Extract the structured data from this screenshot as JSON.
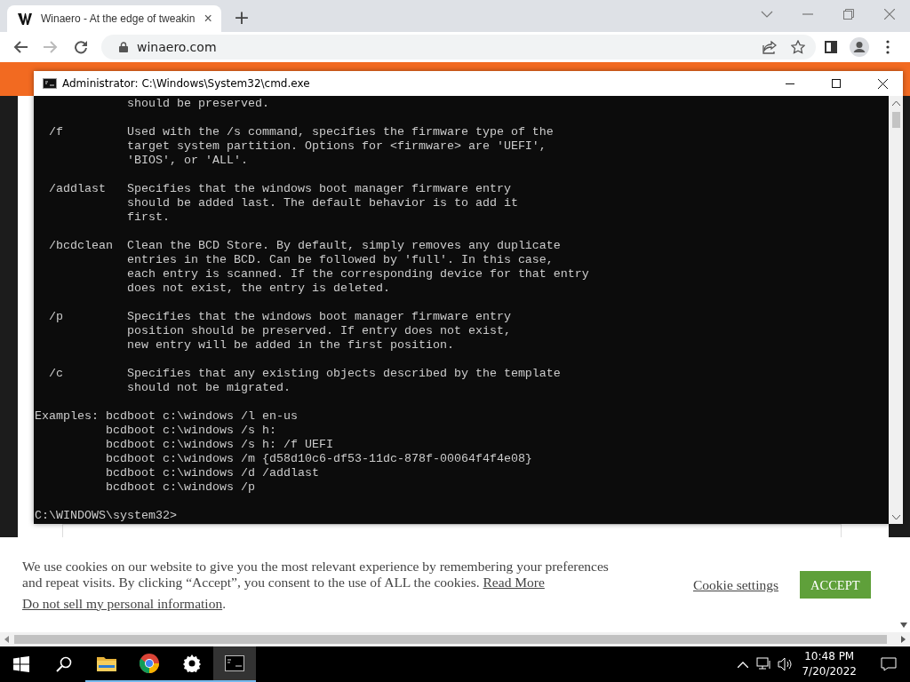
{
  "browser": {
    "tabs": [
      {
        "title": "Winaero - At the edge of tweakin",
        "close": "×",
        "selected": true
      }
    ],
    "new_tab": "+",
    "nav_buttons": [
      {
        "kind": "back",
        "disabled": false
      },
      {
        "kind": "forward",
        "disabled": true
      },
      {
        "kind": "reload",
        "disabled": false
      }
    ],
    "address": "winaero.com"
  },
  "console_window": {
    "title": "Administrator: C:\\Windows\\System32\\cmd.exe",
    "blocks": [
      [
        "             should be preserved."
      ],
      [
        "  /f         Used with the /s command, specifies the firmware type of the",
        "             target system partition. Options for <firmware> are 'UEFI',",
        "             'BIOS', or 'ALL'."
      ],
      [
        "  /addlast   Specifies that the windows boot manager firmware entry",
        "             should be added last. The default behavior is to add it",
        "             first."
      ],
      [
        "  /bcdclean  Clean the BCD Store. By default, simply removes any duplicate",
        "             entries in the BCD. Can be followed by 'full'. In this case,",
        "             each entry is scanned. If the corresponding device for that entry",
        "             does not exist, the entry is deleted."
      ],
      [
        "  /p         Specifies that the windows boot manager firmware entry",
        "             position should be preserved. If entry does not exist,",
        "             new entry will be added in the first position."
      ],
      [
        "  /c         Specifies that any existing objects described by the template",
        "             should not be migrated."
      ],
      [
        "Examples: bcdboot c:\\windows /l en-us",
        "          bcdboot c:\\windows /s h:",
        "          bcdboot c:\\windows /s h: /f UEFI",
        "          bcdboot c:\\windows /m {d58d10c6-df53-11dc-878f-00064f4f4e08}",
        "          bcdboot c:\\windows /d /addlast",
        "          bcdboot c:\\windows /p"
      ],
      [
        "C:\\WINDOWS\\system32>"
      ]
    ]
  },
  "cookie_banner": {
    "notice": "We use cookies on our website to give you the most relevant experience by remembering your preferences and repeat visits. By clicking “Accept”, you consent to the use of ALL the cookies.",
    "read_more": "Read More",
    "do_not_sell": "Do not sell my personal information",
    "do_not_sell_end": ".",
    "settings": "Cookie settings",
    "accept": "ACCEPT"
  },
  "taskbar": {
    "items": [
      {
        "kind": "start",
        "running": false,
        "selected": false
      },
      {
        "kind": "search",
        "running": false,
        "selected": false
      },
      {
        "kind": "explorer",
        "running": true,
        "selected": false
      },
      {
        "kind": "chrome",
        "running": true,
        "selected": false
      },
      {
        "kind": "settings",
        "running": true,
        "selected": false
      },
      {
        "kind": "console",
        "running": true,
        "selected": true
      }
    ],
    "time": "10:48 PM",
    "date": "7/20/2022"
  }
}
